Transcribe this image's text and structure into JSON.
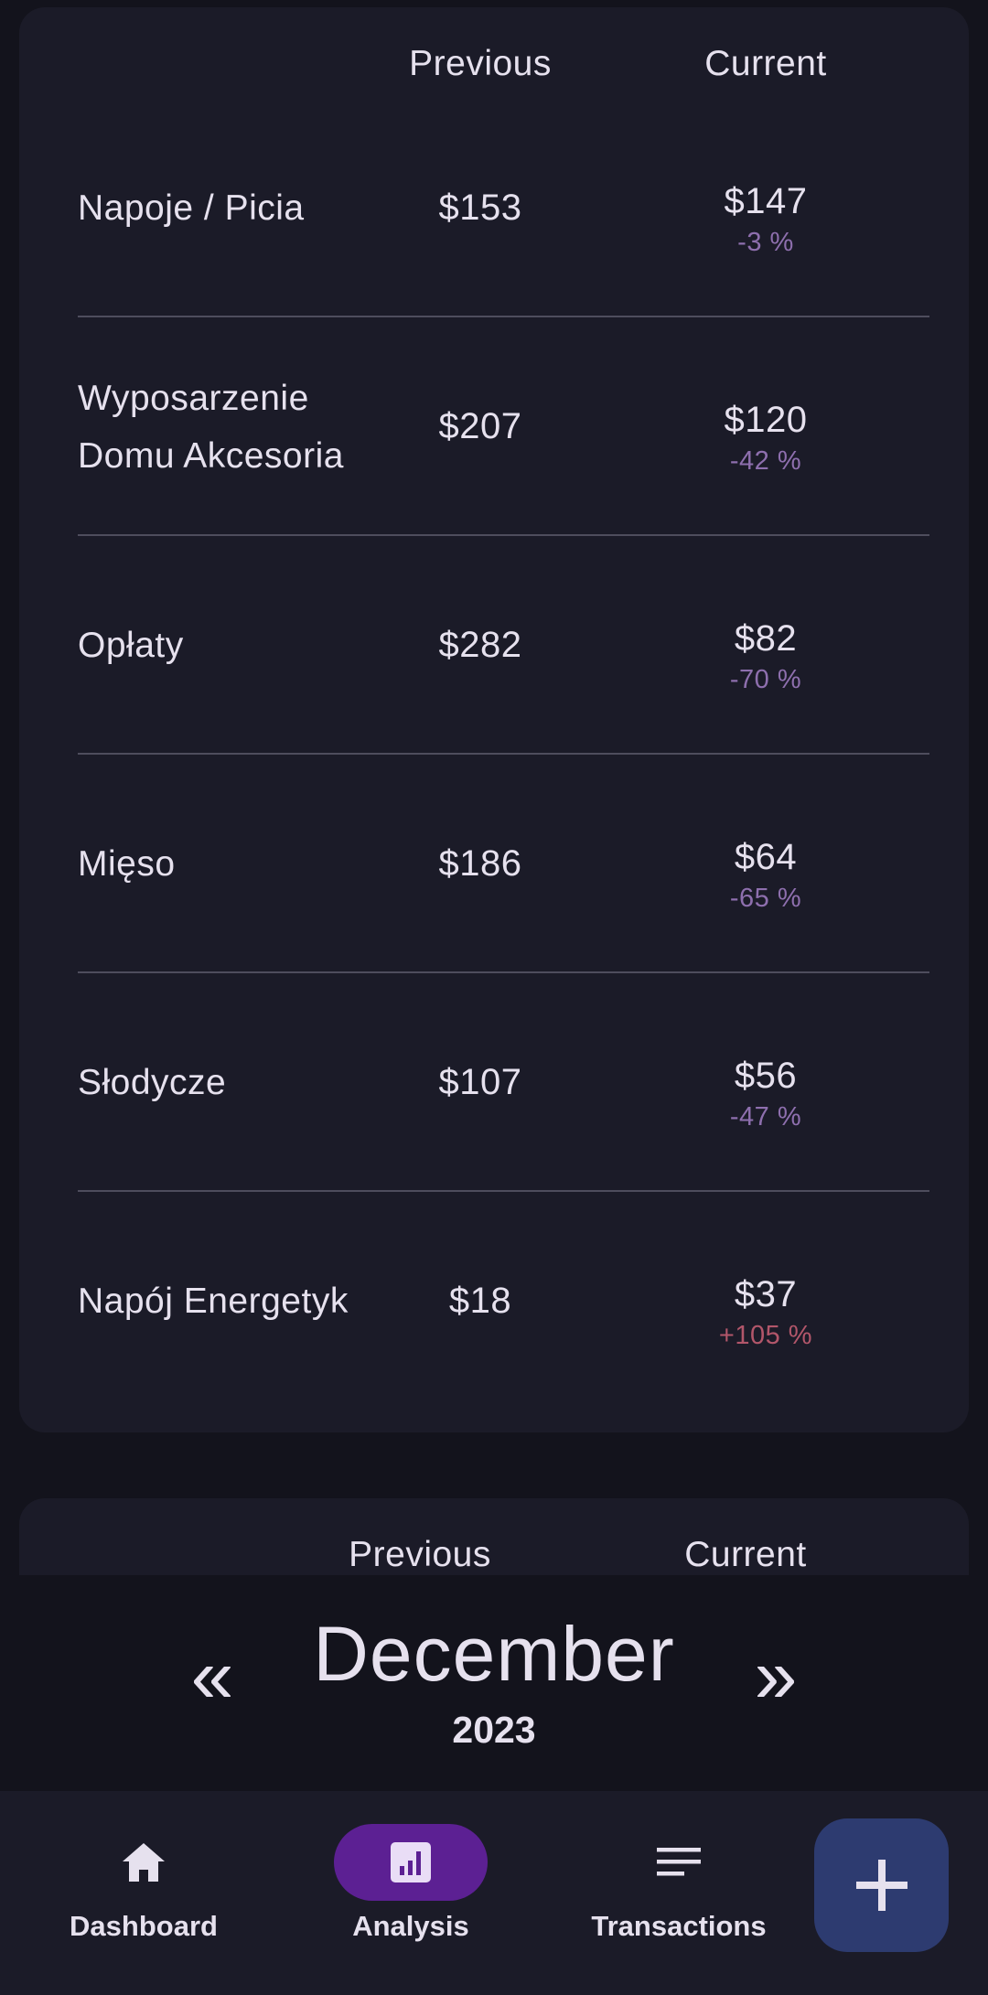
{
  "table1": {
    "header_previous": "Previous",
    "header_current": "Current",
    "rows": [
      {
        "name": "Napoje / Picia",
        "previous": "$153",
        "current": "$147",
        "change": "-3 %"
      },
      {
        "name": "Wyposarzenie Domu Akcesoria",
        "previous": "$207",
        "current": "$120",
        "change": "-42 %"
      },
      {
        "name": "Opłaty",
        "previous": "$282",
        "current": "$82",
        "change": "-70 %"
      },
      {
        "name": "Mięso",
        "previous": "$186",
        "current": "$64",
        "change": "-65 %"
      },
      {
        "name": "Słodycze",
        "previous": "$107",
        "current": "$56",
        "change": "-47 %"
      },
      {
        "name": "Napój Energetyk",
        "previous": "$18",
        "current": "$37",
        "change": "+105 %"
      }
    ]
  },
  "table2": {
    "header_previous": "Previous",
    "header_current": "Current"
  },
  "month_selector": {
    "prev_glyph": "«",
    "next_glyph": "»",
    "month": "December",
    "year": "2023"
  },
  "nav": {
    "items": [
      {
        "label": "Dashboard",
        "icon": "home-icon",
        "active": false
      },
      {
        "label": "Analysis",
        "icon": "analytics-icon",
        "active": true
      },
      {
        "label": "Transactions",
        "icon": "list-icon",
        "active": false
      }
    ]
  },
  "fab": {
    "icon": "plus-icon"
  },
  "colors": {
    "decrease": "#8e6fae",
    "increase": "#b2566a",
    "active_pill": "#5c2093",
    "fab": "#2d3b70",
    "card": "#1b1b28",
    "background": "#13131c"
  }
}
